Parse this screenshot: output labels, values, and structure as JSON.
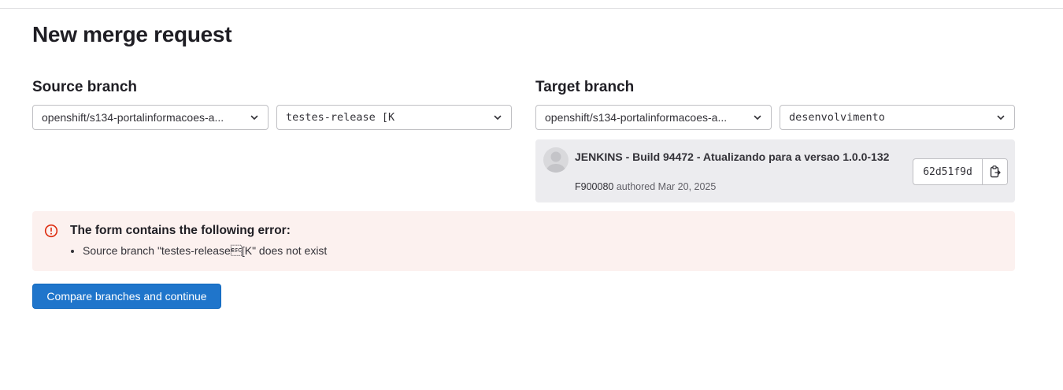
{
  "page": {
    "title": "New merge request"
  },
  "source": {
    "label": "Source branch",
    "project": "openshift/s134-portalinformacoes-a...",
    "branch": "testes-release [K"
  },
  "target": {
    "label": "Target branch",
    "project": "openshift/s134-portalinformacoes-a...",
    "branch": "desenvolvimento"
  },
  "commit": {
    "title": "JENKINS - Build 94472 - Atualizando para a versao 1.0.0-132",
    "author": "F900080",
    "authored_text": "authored Mar 20, 2025",
    "sha": "62d51f9d",
    "copy_icon": "clipboard-icon"
  },
  "error": {
    "icon": "error-circle-icon",
    "title": "The form contains the following error:",
    "items": [
      "Source branch \"testes-release\u001b[K\" does not exist"
    ]
  },
  "actions": {
    "compare_label": "Compare branches and continue"
  },
  "colors": {
    "primary": "#1f75cb",
    "error_bg": "#fcf1ef",
    "error_icon": "#dd2b0e",
    "card_bg": "#ececef"
  }
}
